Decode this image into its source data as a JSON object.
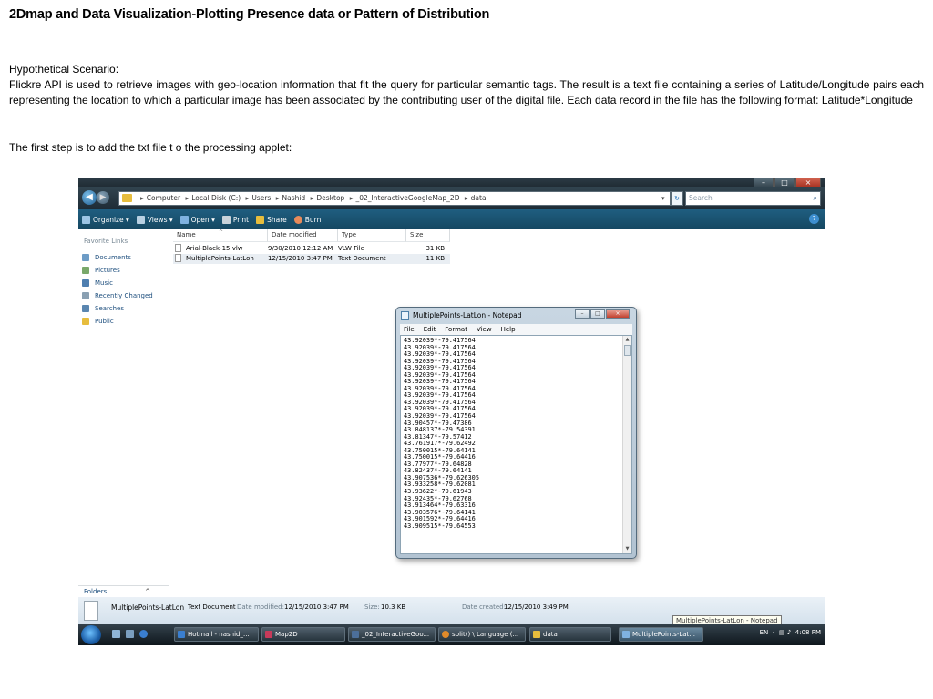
{
  "doc": {
    "title": "2Dmap and Data Visualization-Plotting Presence data or Pattern of Distribution",
    "scenario_heading": "Hypothetical Scenario:",
    "scenario_body": "Flickre API is used to retrieve images with geo-location information that fit the query for particular semantic tags. The result is a text file containing a series of Latitude/Longitude pairs each representing the location to which a particular  image has been associated by the contributing user of the digital file.  Each data record in the file has the following format: Latitude*Longitude",
    "first_step": "The first step is to add the txt file t o the processing applet:"
  },
  "explorer": {
    "breadcrumb": [
      "Computer",
      "Local Disk (C:)",
      "Users",
      "Nashid",
      "Desktop",
      "_02_InteractiveGoogleMap_2D",
      "data"
    ],
    "search_placeholder": "Search",
    "toolbar": {
      "organize": "Organize",
      "views": "Views",
      "open": "Open",
      "print": "Print",
      "share": "Share",
      "burn": "Burn"
    },
    "favorite_links_heading": "Favorite Links",
    "favorite_links": [
      "Documents",
      "Pictures",
      "Music",
      "Recently Changed",
      "Searches",
      "Public"
    ],
    "columns": {
      "name": "Name",
      "date_modified": "Date modified",
      "type": "Type",
      "size": "Size"
    },
    "files": [
      {
        "name": "Arial-Black-15.vlw",
        "date": "9/30/2010 12:12 AM",
        "type": "VLW File",
        "size": "31 KB"
      },
      {
        "name": "MultiplePoints-LatLon",
        "date": "12/15/2010 3:47 PM",
        "type": "Text Document",
        "size": "11 KB"
      }
    ],
    "folders_label": "Folders",
    "details": {
      "file_name": "MultiplePoints-LatLon",
      "file_type": "Text Document",
      "date_modified_label": "Date modified:",
      "date_modified": "12/15/2010 3:47 PM",
      "size_label": "Size:",
      "size": "10.3 KB",
      "date_created_label": "Date created:",
      "date_created": "12/15/2010 3:49 PM"
    },
    "tooltip": "MultiplePoints-LatLon - Notepad"
  },
  "notepad": {
    "title": "MultiplePoints-LatLon - Notepad",
    "menu": [
      "File",
      "Edit",
      "Format",
      "View",
      "Help"
    ],
    "lines": [
      "43.92039*-79.417564",
      "43.92039*-79.417564",
      "43.92039*-79.417564",
      "43.92039*-79.417564",
      "43.92039*-79.417564",
      "43.92039*-79.417564",
      "43.92039*-79.417564",
      "43.92039*-79.417564",
      "43.92039*-79.417564",
      "43.92039*-79.417564",
      "43.92039*-79.417564",
      "43.92039*-79.417564",
      "43.90457*-79.47386",
      "43.848137*-79.54391",
      "43.81347*-79.57412",
      "43.761917*-79.62492",
      "43.750015*-79.64141",
      "43.750015*-79.64416",
      "43.77977*-79.64828",
      "43.82437*-79.64141",
      "43.907536*-79.626305",
      "43.933258*-79.62081",
      "43.93622*-79.61943",
      "43.92435*-79.62768",
      "43.913464*-79.63316",
      "43.903576*-79.64141",
      "43.901592*-79.64416",
      "43.909515*-79.64553"
    ]
  },
  "taskbar": {
    "buttons": [
      {
        "label": "Hotmail - nashid_...",
        "color": "#3a7fd0"
      },
      {
        "label": "Map2D",
        "color": "#c73a5a"
      },
      {
        "label": "_02_InteractiveGoo...",
        "color": "#4c6f9a"
      },
      {
        "label": "split() \\ Language (...",
        "color": "#e08a2a"
      },
      {
        "label": "data",
        "color": "#e7bd3d"
      },
      {
        "label": "MultiplePoints-Lat...",
        "color": "#7fb2e0"
      }
    ],
    "tray_lang": "EN",
    "clock": "4:08 PM"
  },
  "colors": {
    "link_blue": "#1e4f7e",
    "toolbar_blue": "#1f5e80",
    "folder_yellow": "#e7bd3d"
  }
}
